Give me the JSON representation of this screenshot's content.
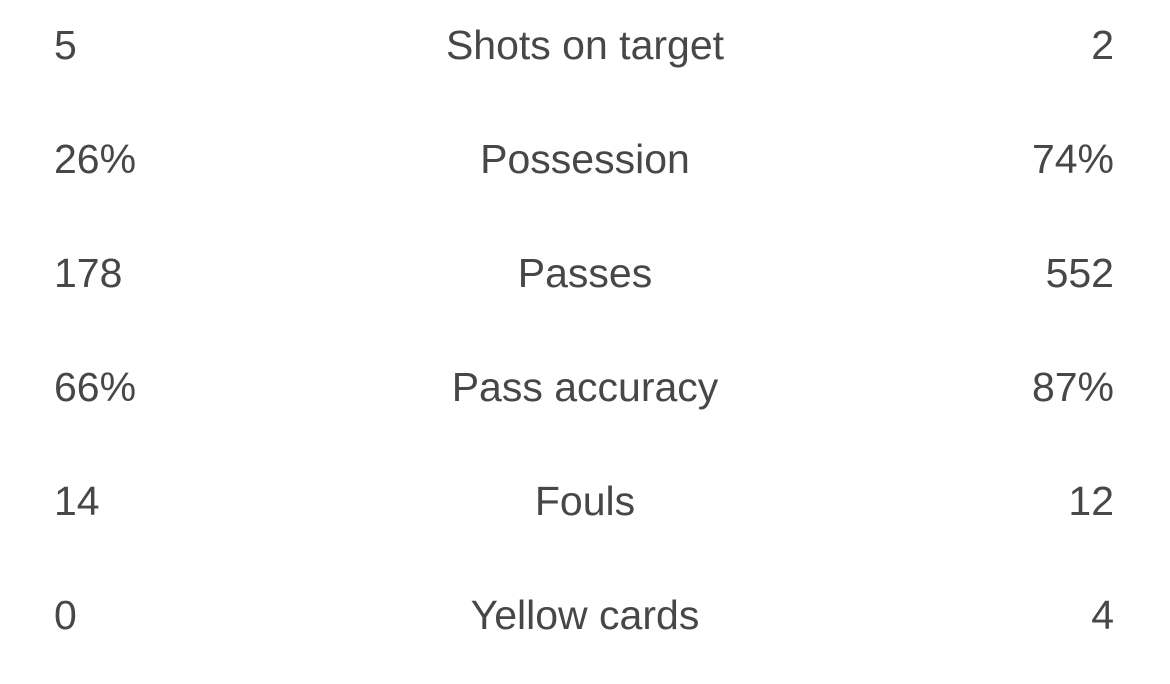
{
  "stats": [
    {
      "label": "Shots on target",
      "home": "5",
      "away": "2"
    },
    {
      "label": "Possession",
      "home": "26%",
      "away": "74%"
    },
    {
      "label": "Passes",
      "home": "178",
      "away": "552"
    },
    {
      "label": "Pass accuracy",
      "home": "66%",
      "away": "87%"
    },
    {
      "label": "Fouls",
      "home": "14",
      "away": "12"
    },
    {
      "label": "Yellow cards",
      "home": "0",
      "away": "4"
    }
  ]
}
